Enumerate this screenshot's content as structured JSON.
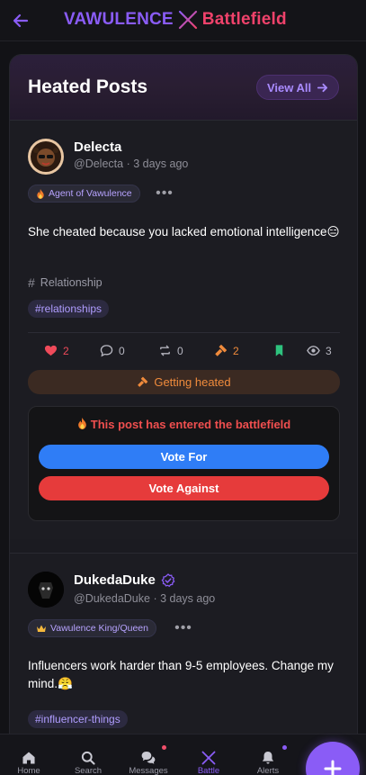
{
  "header": {
    "brand_left": "VAWULENCE",
    "brand_right": "Battlefield",
    "back_icon": "arrow-left-icon",
    "brand_icon": "crossed-swords-icon",
    "colors": {
      "brand_left": "#8a5cf6",
      "brand_right": "#f0426b"
    }
  },
  "panel": {
    "title": "Heated Posts",
    "view_all_label": "View All"
  },
  "posts": [
    {
      "author": "Delecta",
      "handle": "@Delecta",
      "time": "3 days ago",
      "badge": "Agent of Vawulence",
      "badge_icon": "fire-icon",
      "text": "She cheated because you lacked emotional intelligence😑",
      "category": "Relationship",
      "tags": [
        "#relationships"
      ],
      "stats": {
        "likes": "2",
        "comments": "0",
        "reposts": "0",
        "heat": "2",
        "views": "3"
      },
      "heated_label": "Getting heated",
      "battle_message": "This post has entered the battlefield",
      "vote_for": "Vote For",
      "vote_against": "Vote Against"
    },
    {
      "author": "DukedaDuke",
      "handle": "@DukedaDuke",
      "time": "3 days ago",
      "badge": "Vawulence King/Queen",
      "badge_icon": "crown-icon",
      "verified": true,
      "text": "Influencers work harder than 9-5 employees. Change my mind.😤",
      "tags": [
        "#influencer-things"
      ]
    }
  ],
  "nav": {
    "items": [
      {
        "label": "Home",
        "icon": "home-icon"
      },
      {
        "label": "Search",
        "icon": "search-icon"
      },
      {
        "label": "Messages",
        "icon": "chat-icon"
      },
      {
        "label": "Battle",
        "icon": "crossed-swords-icon"
      },
      {
        "label": "Alerts",
        "icon": "bell-icon"
      }
    ],
    "active": "Battle",
    "fab_icon": "plus-icon"
  }
}
